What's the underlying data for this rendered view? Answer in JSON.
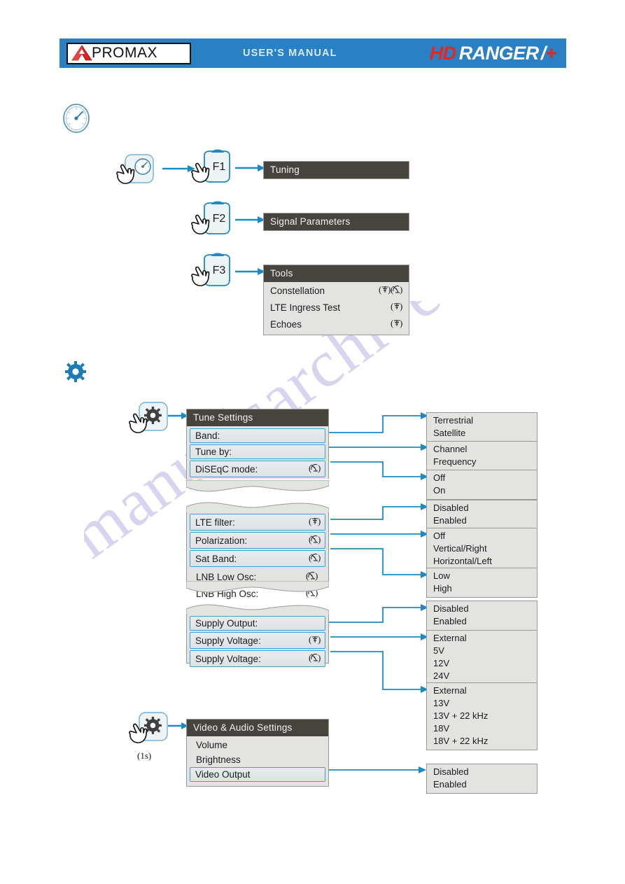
{
  "header": {
    "brand": "PROMAX",
    "manual_label": "USER'S  MANUAL",
    "product_hd": "HD",
    "product_ranger": "RANGER",
    "product_slash": "/",
    "product_plus": "+",
    "bar_color": "#2980c4",
    "accent_red": "#e8251e"
  },
  "section_measure": {
    "icon": "gauge-icon",
    "keys": [
      {
        "key_label": "F1",
        "menu_title": "Tuning",
        "items": []
      },
      {
        "key_label": "F2",
        "menu_title": "Signal Parameters",
        "items": []
      },
      {
        "key_label": "F3",
        "menu_title": "Tools",
        "items": [
          {
            "label": "Constellation",
            "icons": "(ᐁ)( ✶ )",
            "modes": "terrestrial satellite"
          },
          {
            "label": "LTE Ingress Test",
            "icons": "(ᐁ)",
            "modes": "terrestrial"
          },
          {
            "label": "Echoes",
            "icons": "(ᐁ)",
            "modes": "terrestrial"
          }
        ]
      }
    ]
  },
  "section_settings": {
    "icon": "gear-icon",
    "tune_settings": {
      "title": "Tune Settings",
      "rows": [
        {
          "label": "Band:",
          "icons": "",
          "highlighted": true
        },
        {
          "label": "Tune by:",
          "icons": "",
          "highlighted": true
        },
        {
          "label": "DiSEqC mode:",
          "icons": "(sat)",
          "highlighted": true
        }
      ]
    },
    "sheet_two": {
      "rows": [
        {
          "label": "LTE filter:",
          "icons": "(ant)",
          "highlighted": true
        },
        {
          "label": "Polarization:",
          "icons": "(sat)",
          "highlighted": true
        },
        {
          "label": "Sat Band:",
          "icons": "(sat)",
          "highlighted": true
        },
        {
          "label": "LNB Low Osc:",
          "icons": "(sat)",
          "highlighted": false
        },
        {
          "label": "LNB High Osc:",
          "icons": "(sat)",
          "highlighted": false
        }
      ]
    },
    "sheet_three": {
      "rows": [
        {
          "label": "Supply Output:",
          "icons": "",
          "highlighted": true
        },
        {
          "label": "Supply Voltage:",
          "icons": "(ant)",
          "highlighted": true
        },
        {
          "label": "Supply Voltage:",
          "icons": "(sat)",
          "highlighted": true
        }
      ]
    },
    "video_audio": {
      "title": "Video & Audio Settings",
      "hold_note": "(1s)",
      "rows": [
        {
          "label": "Volume",
          "highlighted": false
        },
        {
          "label": "Brightness",
          "highlighted": false
        },
        {
          "label": "Video Output",
          "highlighted": true
        }
      ]
    },
    "option_boxes": [
      {
        "id": "band",
        "items": [
          "Terrestrial",
          "Satellite"
        ]
      },
      {
        "id": "tune-by",
        "items": [
          "Channel",
          "Frequency"
        ]
      },
      {
        "id": "diseqc-mode",
        "items": [
          "Off",
          "On"
        ]
      },
      {
        "id": "lte-filter",
        "items": [
          "Disabled",
          "Enabled"
        ]
      },
      {
        "id": "polarization",
        "items": [
          "Off",
          "Vertical/Right",
          "Horizontal/Left"
        ]
      },
      {
        "id": "sat-band",
        "items": [
          "Low",
          "High"
        ]
      },
      {
        "id": "supply-output",
        "items": [
          "Disabled",
          "Enabled"
        ]
      },
      {
        "id": "supply-voltage-terrestrial",
        "items": [
          "External",
          "5V",
          "12V",
          "24V"
        ]
      },
      {
        "id": "supply-voltage-satellite",
        "items": [
          "External",
          "13V",
          "13V + 22 kHz",
          "18V",
          "18V + 22 kHz"
        ]
      },
      {
        "id": "video-output",
        "items": [
          "Disabled",
          "Enabled"
        ]
      }
    ]
  },
  "watermark": {
    "text": "manualsarchive.com"
  },
  "colors": {
    "menu_header": "#474440",
    "menu_body": "#e3e3e1",
    "connector_blue": "#1b8ac4",
    "highlight_border": "#3f9fd0"
  }
}
